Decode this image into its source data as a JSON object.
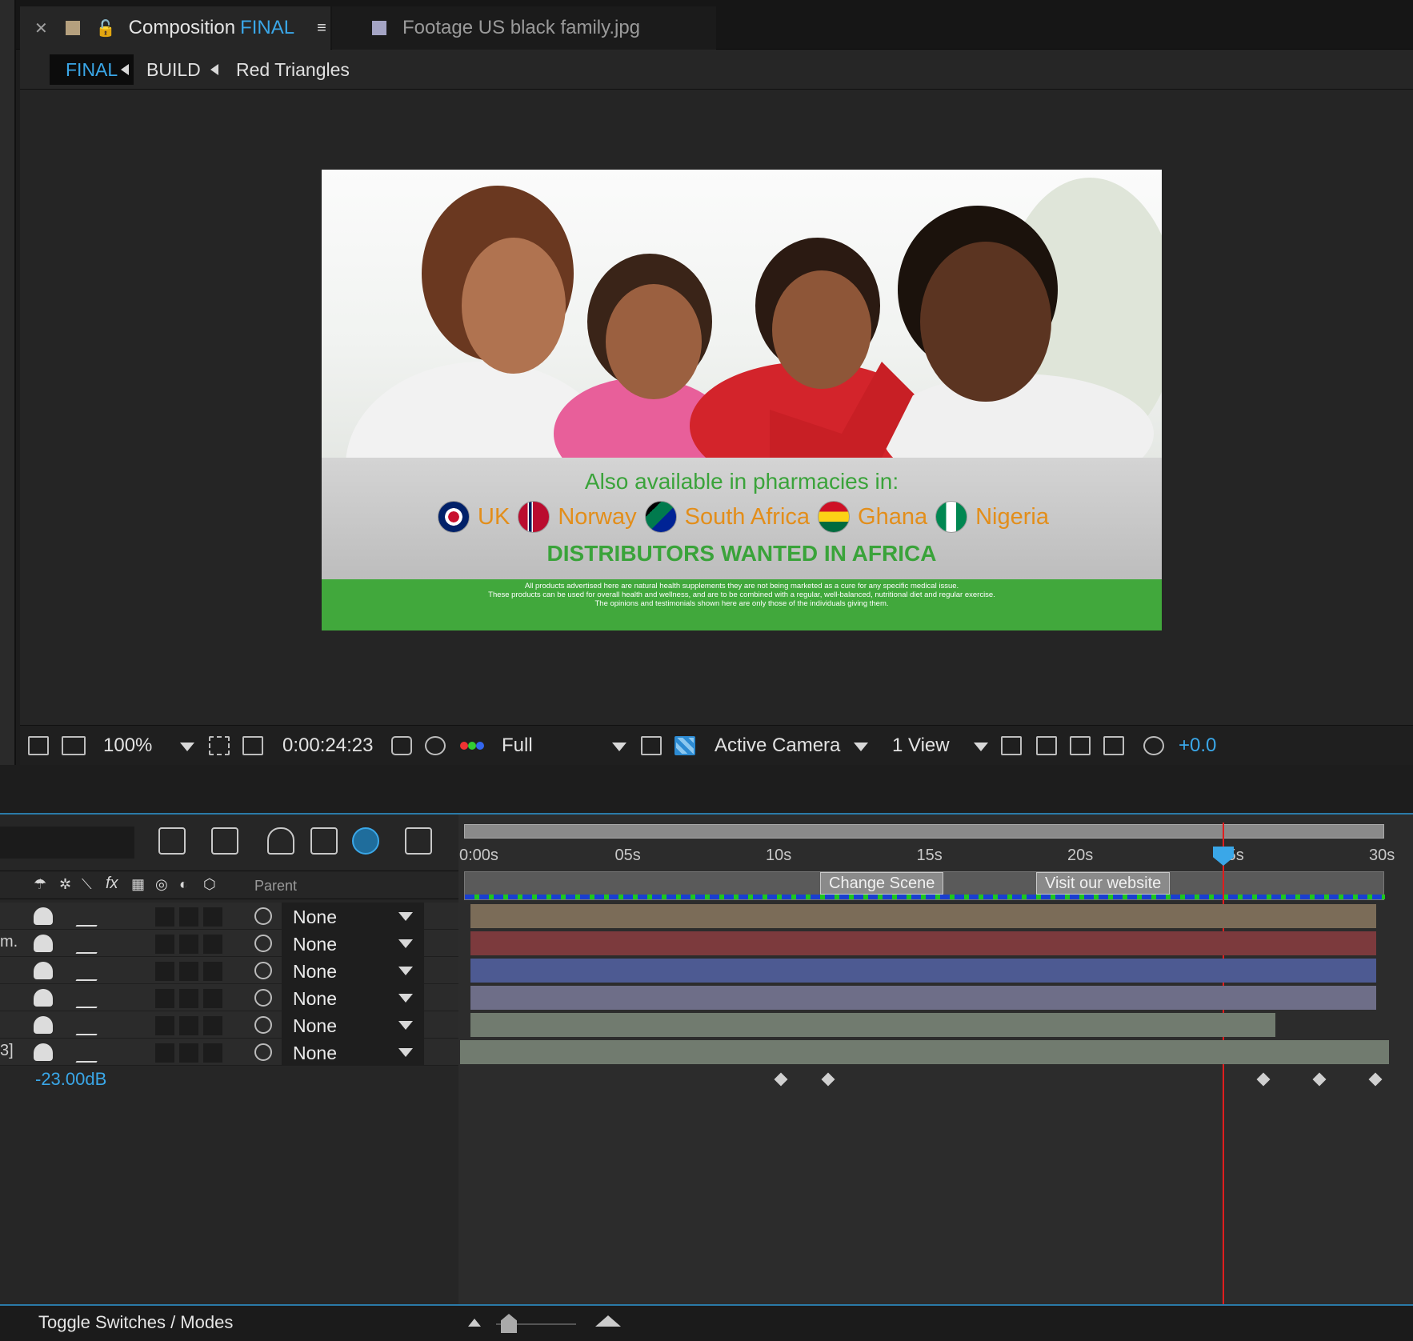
{
  "tabs": {
    "comp_prefix": "Composition",
    "comp_name": "FINAL",
    "footage": "Footage US black family.jpg"
  },
  "breadcrumb": [
    "FINAL",
    "BUILD",
    "Red Triangles"
  ],
  "ad": {
    "line1": "Also available in pharmacies in:",
    "countries": [
      "UK",
      "Norway",
      "South Africa",
      "Ghana",
      "Nigeria"
    ],
    "line3": "DISTRIBUTORS WANTED IN AFRICA",
    "disclaimer": [
      "All products advertised here are natural health supplements they are not being marketed as a cure for any specific medical issue.",
      "These products can be used for overall health and wellness, and are to be combined with a regular, well-balanced, nutritional diet and regular exercise.",
      "The opinions and testimonials shown here are only those of the individuals giving them."
    ]
  },
  "toolbar": {
    "zoom": "100%",
    "timecode": "0:00:24:23",
    "resolution": "Full",
    "camera": "Active Camera",
    "views": "1 View",
    "exposure": "+0.0"
  },
  "timeline": {
    "column_parent": "Parent",
    "ruler": [
      "0:00s",
      "05s",
      "10s",
      "15s",
      "20s",
      "25s",
      "30s"
    ],
    "markers": [
      "Change Scene",
      "Visit our website"
    ],
    "audio_level": "-23.00dB",
    "rows": [
      {
        "lbl": "",
        "parent": "None",
        "color": "#7b6c58"
      },
      {
        "lbl": "m.",
        "parent": "None",
        "color": "#7c3a3d"
      },
      {
        "lbl": "",
        "parent": "None",
        "color": "#4d5a92"
      },
      {
        "lbl": "",
        "parent": "None",
        "color": "#6e6e88"
      },
      {
        "lbl": "",
        "parent": "None",
        "color": "#717b6f"
      },
      {
        "lbl": "3]",
        "parent": "None",
        "color": "#717b6f"
      }
    ]
  },
  "footer": {
    "toggle": "Toggle Switches / Modes"
  }
}
